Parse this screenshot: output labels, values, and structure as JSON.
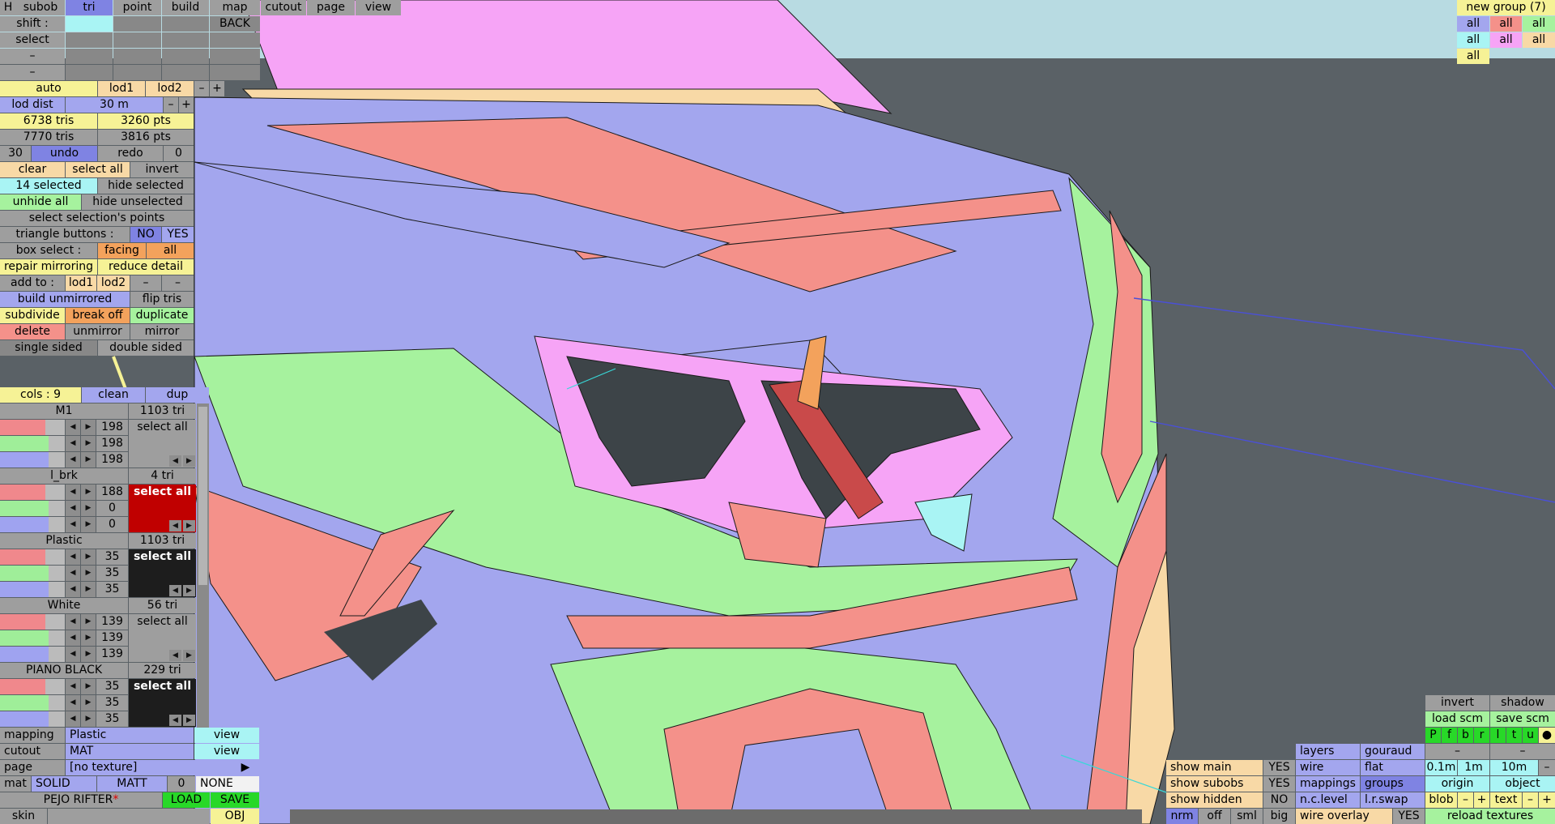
{
  "colors": {
    "pink": "#f6a4f6",
    "blue": "#a3a6ee",
    "peach": "#f8d9a6",
    "salmon": "#f4918a",
    "green": "#a6f29e",
    "cyan": "#a9f4f4",
    "yellow": "#f6f296",
    "orange": "#f3a25c",
    "ground": "#5a6166",
    "sky": "#b8dbe2"
  },
  "toolbar": {
    "h": "H",
    "subob": "subob",
    "tri": "tri",
    "point": "point",
    "build": "build",
    "map": "map",
    "cutout": "cutout",
    "page": "page",
    "view": "view"
  },
  "rows": {
    "shift": "shift :",
    "back": "BACK",
    "select": "select",
    "dash": "–"
  },
  "lod": {
    "auto": "auto",
    "lod1": "lod1",
    "lod2": "lod2",
    "minus": "–",
    "plus": "+",
    "dist_label": "lod dist",
    "dist_value": "30 m"
  },
  "stats": {
    "tris1": "6738 tris",
    "pts1": "3260 pts",
    "tris2": "7770 tris",
    "pts2": "3816 pts"
  },
  "history": {
    "left": "30",
    "undo": "undo",
    "redo": "redo",
    "right": "0"
  },
  "ops": {
    "clear": "clear",
    "select_all": "select all",
    "invert": "invert",
    "selected": "14 selected",
    "hide_selected": "hide selected",
    "unhide_all": "unhide all",
    "hide_unselected": "hide unselected",
    "select_points": "select selection's points",
    "tri_buttons": "triangle buttons :",
    "no": "NO",
    "yes": "YES",
    "box_select": "box select :",
    "facing": "facing",
    "all": "all",
    "repair_mirroring": "repair mirroring",
    "reduce_detail": "reduce detail",
    "add_to": "add to :",
    "lod1": "lod1",
    "lod2": "lod2",
    "dash": "–",
    "build_unmirrored": "build unmirrored",
    "flip_tris": "flip tris",
    "subdivide": "subdivide",
    "break_off": "break off",
    "duplicate": "duplicate",
    "delete": "delete",
    "unmirror": "unmirror",
    "mirror": "mirror",
    "single_sided": "single sided",
    "double_sided": "double sided"
  },
  "cols": {
    "label": "cols : 9",
    "clean": "clean",
    "dup": "dup"
  },
  "materials": [
    {
      "name": "M1",
      "tris": "1103 tri",
      "r": "198",
      "g": "198",
      "b": "198",
      "btn": "select all",
      "style": "gray"
    },
    {
      "name": "l_brk",
      "tris": "4 tri",
      "r": "188",
      "g": "0",
      "b": "0",
      "btn": "select all",
      "style": "red"
    },
    {
      "name": "Plastic",
      "tris": "1103 tri",
      "r": "35",
      "g": "35",
      "b": "35",
      "btn": "select all",
      "style": "black"
    },
    {
      "name": "White",
      "tris": "56 tri",
      "r": "139",
      "g": "139",
      "b": "139",
      "btn": "select all",
      "style": "gray"
    },
    {
      "name": "PIANO BLACK",
      "tris": "229 tri",
      "r": "35",
      "g": "35",
      "b": "35",
      "btn": "select all",
      "style": "black"
    }
  ],
  "arrows": {
    "left": "◀",
    "right": "▶"
  },
  "bottom_left": {
    "mapping_label": "mapping",
    "mapping_value": "Plastic",
    "view": "view",
    "cutout_label": "cutout",
    "cutout_value": "MAT",
    "page_label": "page",
    "page_value": "[no texture]",
    "page_arrow": "▶",
    "mat": "mat",
    "solid": "SOLID",
    "matt": "MATT",
    "zero": "0",
    "none": "NONE",
    "car_name": "PEJO RIFTER",
    "star": "*",
    "load": "LOAD",
    "save": "SAVE",
    "skin": "skin",
    "obj": "OBJ"
  },
  "groups": {
    "title": "new group (7)",
    "all": "all"
  },
  "right_panel": {
    "invert": "invert",
    "shadow": "shadow",
    "load_scm": "load scm",
    "save_scm": "save scm",
    "letters": [
      "P",
      "f",
      "b",
      "r",
      "l",
      "t",
      "u",
      "●"
    ],
    "layers": "layers",
    "gouraud": "gouraud",
    "dash": "–",
    "wire": "wire",
    "flat": "flat",
    "d01": "0.1m",
    "d1": "1m",
    "d10": "10m",
    "mappings": "mappings",
    "groups": "groups",
    "origin": "origin",
    "object": "object",
    "nclevel": "n.c.level",
    "lrswap": "l.r.swap",
    "blob": "blob",
    "minus": "–",
    "plus": "+",
    "text": "text",
    "wire_overlay": "wire overlay",
    "yes": "YES",
    "reload": "reload textures"
  },
  "show": {
    "main": "show main",
    "subobs": "show subobs",
    "hidden": "show hidden",
    "yes": "YES",
    "no": "NO",
    "nrm": "nrm",
    "off": "off",
    "sml": "sml",
    "big": "big"
  }
}
